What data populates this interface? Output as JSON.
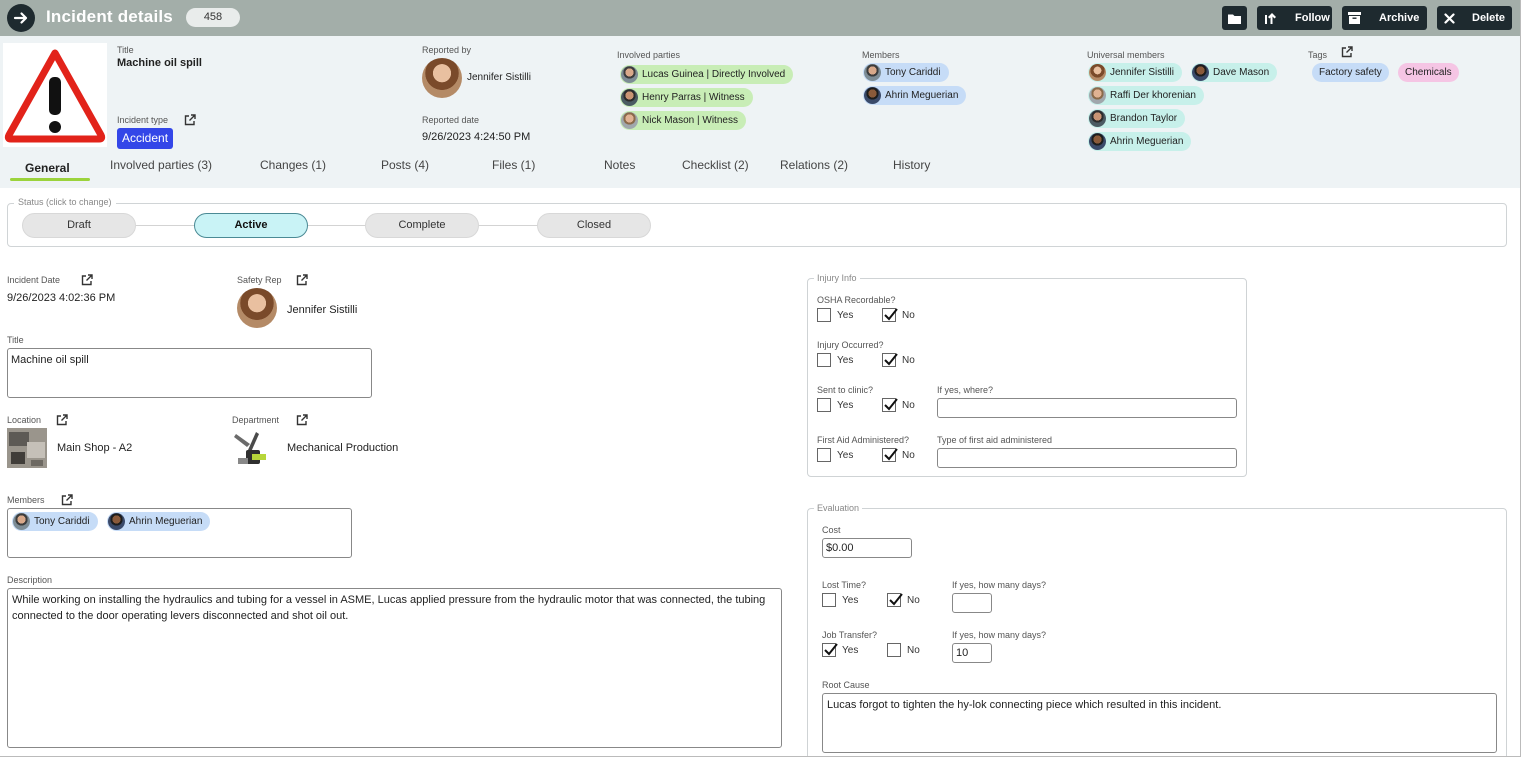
{
  "topbar": {
    "title": "Incident details",
    "count": "458",
    "buttons": {
      "follow": "Follow",
      "archive": "Archive",
      "delete": "Delete"
    }
  },
  "header": {
    "title_label": "Title",
    "title_value": "Machine oil spill",
    "incident_type_label": "Incident type",
    "incident_type_value": "Accident",
    "reported_by_label": "Reported by",
    "reported_by_value": "Jennifer Sistilli",
    "reported_date_label": "Reported date",
    "reported_date_value": "9/26/2023 4:24:50 PM",
    "involved_parties_label": "Involved parties",
    "involved_parties": [
      "Lucas Guinea | Directly Involved",
      "Henry Parras | Witness",
      "Nick Mason | Witness"
    ],
    "members_label": "Members",
    "members": [
      "Tony Cariddi",
      "Ahrin Meguerian"
    ],
    "universal_members_label": "Universal members",
    "universal_members": [
      "Jennifer Sistilli",
      "Dave Mason",
      "Raffi Der khorenian",
      "Brandon Taylor",
      "Ahrin Meguerian"
    ],
    "tags_label": "Tags",
    "tags": [
      "Factory safety",
      "Chemicals"
    ]
  },
  "tabs": [
    "General",
    "Involved parties (3)",
    "Changes (1)",
    "Posts (4)",
    "Files (1)",
    "Notes",
    "Checklist (2)",
    "Relations (2)",
    "History"
  ],
  "status": {
    "legend": "Status (click to change)",
    "steps": [
      "Draft",
      "Active",
      "Complete",
      "Closed"
    ],
    "active": "Active"
  },
  "form": {
    "incident_date_label": "Incident Date",
    "incident_date_value": "9/26/2023 4:02:36 PM",
    "safety_rep_label": "Safety Rep",
    "safety_rep_value": "Jennifer Sistilli",
    "title_label": "Title",
    "title_value": "Machine oil spill",
    "location_label": "Location",
    "location_value": "Main Shop - A2",
    "department_label": "Department",
    "department_value": "Mechanical Production",
    "members_label": "Members",
    "members": [
      "Tony Cariddi",
      "Ahrin Meguerian"
    ],
    "description_label": "Description",
    "description_value": "While working on installing the hydraulics and tubing for a vessel in ASME, Lucas applied pressure from the hydraulic motor that was connected, the tubing connected to the door operating levers disconnected and shot oil out."
  },
  "injury": {
    "legend": "Injury Info",
    "osha_label": "OSHA Recordable?",
    "injury_label": "Injury Occurred?",
    "clinic_label": "Sent to clinic?",
    "clinic_where_label": "If yes, where?",
    "firstaid_label": "First Aid Administered?",
    "firstaid_type_label": "Type of first aid administered",
    "yes": "Yes",
    "no": "No"
  },
  "evaluation": {
    "legend": "Evaluation",
    "cost_label": "Cost",
    "cost_value": "$0.00",
    "lost_time_label": "Lost Time?",
    "lost_days_label": "If yes, how many days?",
    "lost_days_value": "",
    "job_transfer_label": "Job Transfer?",
    "transfer_days_label": "If yes, how many days?",
    "transfer_days_value": "10",
    "root_cause_label": "Root Cause",
    "root_cause_value": "Lucas forgot to tighten the hy-lok connecting piece which resulted in this incident.",
    "yes": "Yes",
    "no": "No"
  },
  "colors": {
    "topbar": "#a3aea9",
    "dark_button": "#1e2a2f",
    "header_bg": "#eef3f5",
    "accident_badge": "#3346e8",
    "active_tab_underline": "#9bd33c",
    "active_status": "#c9f3f6"
  }
}
